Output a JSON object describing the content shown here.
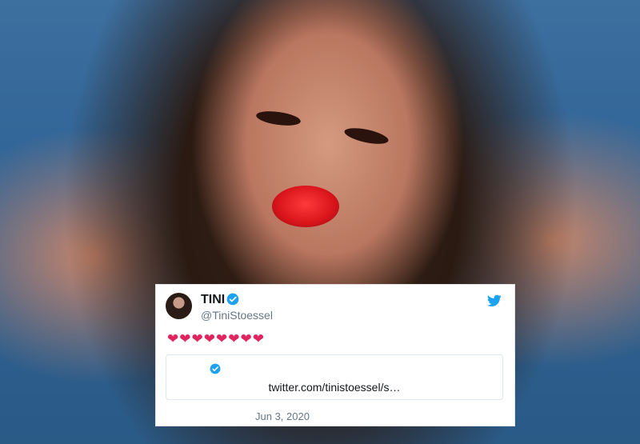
{
  "tweet": {
    "display_name": "TINI",
    "handle": "@TiniStoessel",
    "text": "❤❤❤❤❤❤❤❤",
    "card": {
      "link": "twitter.com/tinistoessel/s…"
    },
    "date": "Jun 3, 2020"
  },
  "icons": {
    "verified": "verified-badge-icon",
    "brand": "twitter-bird-icon"
  },
  "colors": {
    "twitter_blue": "#1da1f2",
    "heart_red": "#e0245e",
    "lip_red": "#d8141b"
  }
}
